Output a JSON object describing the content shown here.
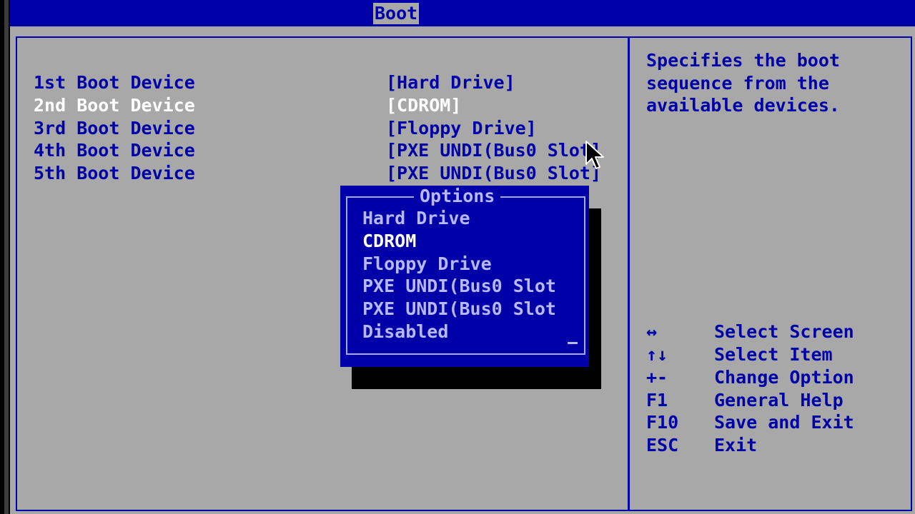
{
  "header": {
    "active_tab": "Boot"
  },
  "boot_devices": [
    {
      "label": "1st Boot Device",
      "value": "[Hard Drive]",
      "selected": false
    },
    {
      "label": "2nd Boot Device",
      "value": "[CDROM]",
      "selected": true
    },
    {
      "label": "3rd Boot Device",
      "value": "[Floppy Drive]",
      "selected": false
    },
    {
      "label": "4th Boot Device",
      "value": "[PXE UNDI(Bus0 Slot]",
      "selected": false
    },
    {
      "label": "5th Boot Device",
      "value": "[PXE UNDI(Bus0 Slot]",
      "selected": false
    }
  ],
  "options_popup": {
    "title": "Options",
    "items": [
      "Hard Drive",
      "CDROM",
      "Floppy Drive",
      "PXE UNDI(Bus0 Slot",
      "PXE UNDI(Bus0 Slot",
      "Disabled"
    ],
    "selected_item": "CDROM"
  },
  "help": {
    "lines": [
      "Specifies the boot",
      "sequence from the",
      "available devices."
    ]
  },
  "keys": [
    {
      "key": "↔",
      "action": "Select Screen"
    },
    {
      "key": "↑↓",
      "action": "Select Item"
    },
    {
      "key": "+-",
      "action": "Change Option"
    },
    {
      "key": "F1",
      "action": "General Help"
    },
    {
      "key": "F10",
      "action": "Save and Exit"
    },
    {
      "key": "ESC",
      "action": "Exit"
    }
  ],
  "colors": {
    "background": "#a8a8a8",
    "accent": "#0000a8",
    "highlight": "#ffffff"
  }
}
